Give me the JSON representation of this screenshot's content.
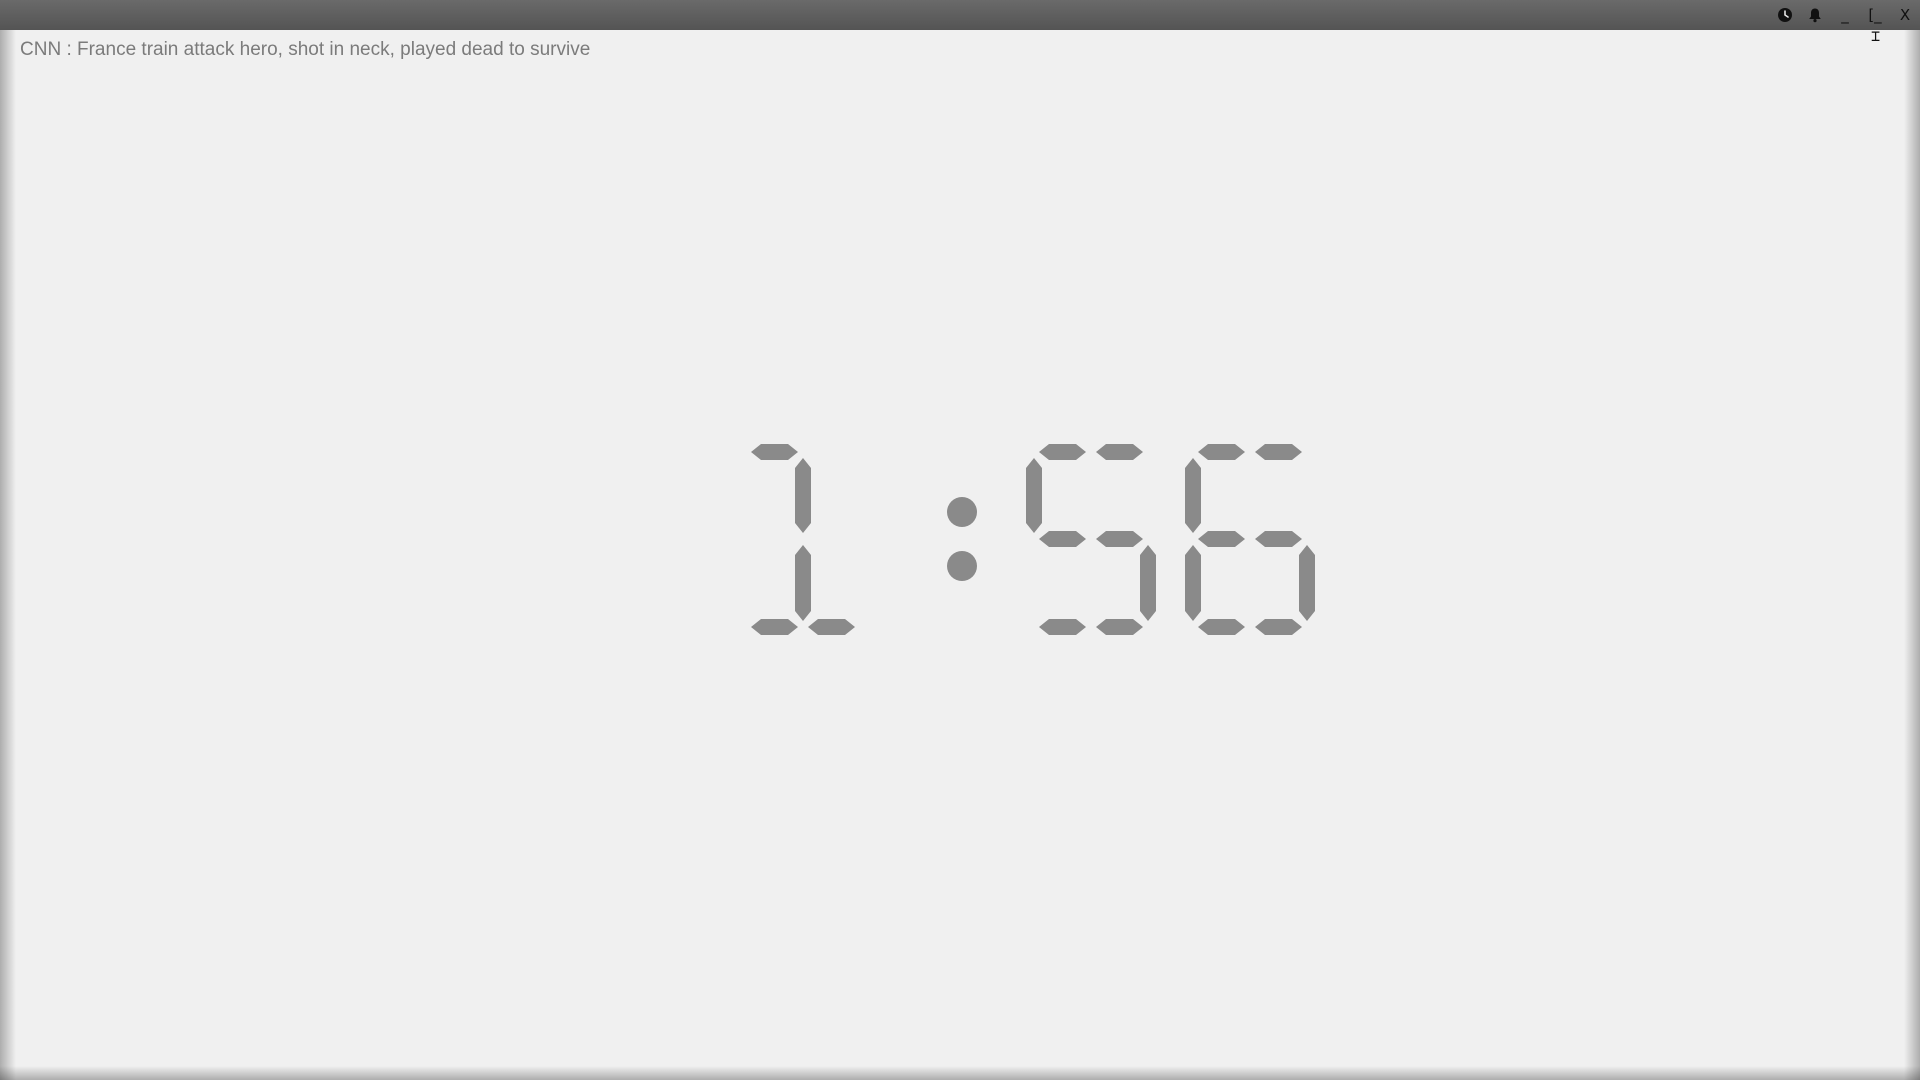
{
  "window": {
    "controls": {
      "minimize_label": "_",
      "maximize_label": "[_",
      "close_label": "X"
    }
  },
  "ticker": {
    "text": "CNN : France train attack hero, shot in neck, played dead to survive"
  },
  "clock": {
    "time_text": "1:56",
    "digits": [
      "1",
      "5",
      "6"
    ],
    "segment_color": "#8a8a8a"
  },
  "icons": {
    "alarm": "alarm-clock-icon",
    "notification": "bell-icon"
  }
}
